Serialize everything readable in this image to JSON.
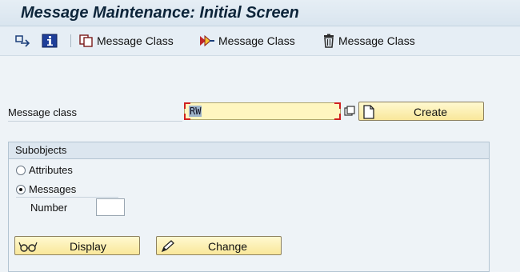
{
  "window": {
    "title": "Message Maintenance: Initial Screen"
  },
  "toolbar": {
    "buttons": [
      {
        "icon": "other-object-icon"
      },
      {
        "icon": "info-icon"
      },
      {
        "icon": "copy-icon",
        "label": "Message Class"
      },
      {
        "icon": "rename-icon",
        "label": "Message Class"
      },
      {
        "icon": "delete-icon",
        "label": "Message Class"
      }
    ]
  },
  "form": {
    "message_class": {
      "label": "Message class",
      "value": "RW"
    },
    "create_button": {
      "label": "Create",
      "icon": "new-document-icon"
    }
  },
  "subobjects": {
    "title": "Subobjects",
    "options": [
      {
        "label": "Attributes",
        "selected": false
      },
      {
        "label": "Messages",
        "selected": true
      }
    ],
    "number": {
      "label": "Number",
      "value": ""
    }
  },
  "actions": {
    "display": {
      "label": "Display",
      "icon": "glasses-icon"
    },
    "change": {
      "label": "Change",
      "icon": "pencil-icon"
    }
  }
}
